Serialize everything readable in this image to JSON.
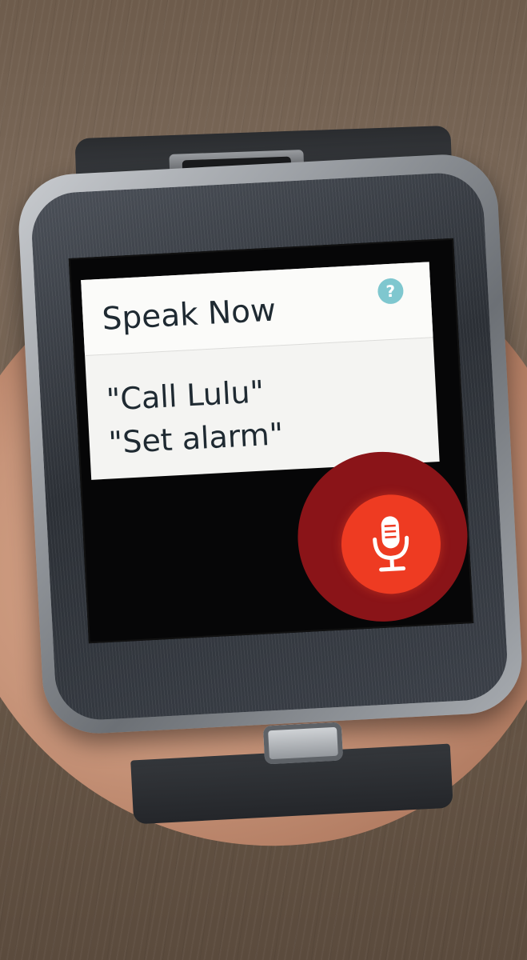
{
  "voice_prompt": {
    "title": "Speak Now",
    "help_icon": "question-mark-icon",
    "help_label": "?",
    "examples": [
      "\"Call Lulu\"",
      "\"Set alarm\""
    ],
    "mic_icon": "microphone-icon"
  },
  "colors": {
    "card_background": "#f4f4f2",
    "mic_button": "#ee3b22",
    "mic_glow": "#8a1418",
    "help_icon": "#7fc7cf",
    "screen_background": "#060607"
  }
}
